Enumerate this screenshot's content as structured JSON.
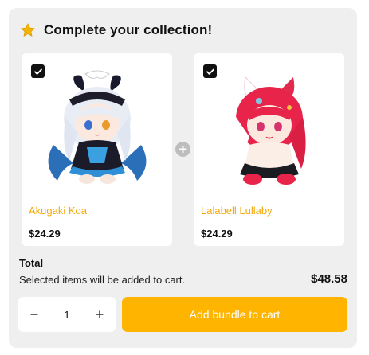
{
  "header": {
    "title": "Complete your collection!",
    "icon": "star-icon"
  },
  "products": [
    {
      "name": "Akugaki Koa",
      "price": "$24.29",
      "selected": true
    },
    {
      "name": "Lalabell Lullaby",
      "price": "$24.29",
      "selected": true
    }
  ],
  "total": {
    "label": "Total",
    "note": "Selected items will be added to cart.",
    "amount": "$48.58"
  },
  "quantity": {
    "value": "1"
  },
  "actions": {
    "add_label": "Add bundle to cart"
  },
  "colors": {
    "accent": "#ffb400",
    "product_name": "#f5a80a",
    "panel": "#efefef"
  }
}
